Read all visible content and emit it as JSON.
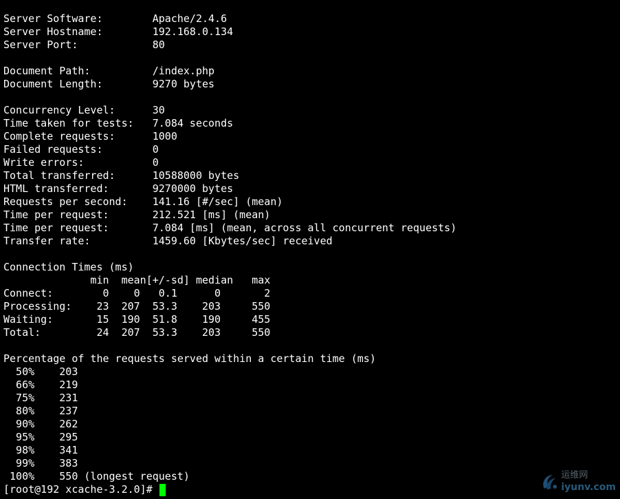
{
  "server": {
    "software": "Server Software:        Apache/2.4.6",
    "hostname": "Server Hostname:        192.168.0.134",
    "port": "Server Port:            80"
  },
  "document": {
    "path": "Document Path:          /index.php",
    "length": "Document Length:        9270 bytes"
  },
  "stats": [
    "Concurrency Level:      30",
    "Time taken for tests:   7.084 seconds",
    "Complete requests:      1000",
    "Failed requests:        0",
    "Write errors:           0",
    "Total transferred:      10588000 bytes",
    "HTML transferred:       9270000 bytes",
    "Requests per second:    141.16 [#/sec] (mean)",
    "Time per request:       212.521 [ms] (mean)",
    "Time per request:       7.084 [ms] (mean, across all concurrent requests)",
    "Transfer rate:          1459.60 [Kbytes/sec] received"
  ],
  "connection_times": {
    "title": "Connection Times (ms)",
    "header": "              min  mean[+/-sd] median   max",
    "rows": [
      "Connect:        0    0   0.1      0       2",
      "Processing:    23  207  53.3    203     550",
      "Waiting:       15  190  51.8    190     455",
      "Total:         24  207  53.3    203     550"
    ]
  },
  "percentiles": {
    "title": "Percentage of the requests served within a certain time (ms)",
    "rows": [
      "  50%    203",
      "  66%    219",
      "  75%    231",
      "  80%    237",
      "  90%    262",
      "  95%    295",
      "  98%    341",
      "  99%    383",
      " 100%    550 (longest request)"
    ]
  },
  "prompt": "[root@192 xcache-3.2.0]# ",
  "colors": {
    "background": "#000000",
    "text": "#ffffff",
    "cursor": "#00ff00"
  },
  "watermark": {
    "icon": "watermark-logo-icon",
    "cn": "运维网",
    "en": "iyunv.com"
  }
}
